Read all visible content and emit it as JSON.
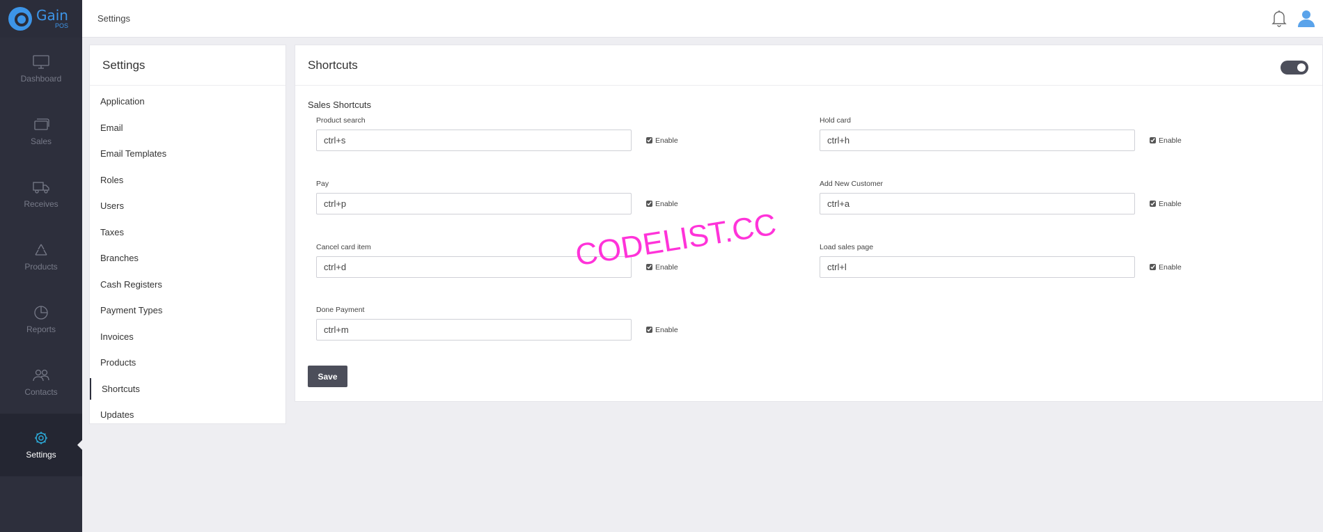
{
  "brand": {
    "name": "Gain",
    "sub": "POS"
  },
  "nav": [
    {
      "key": "dashboard",
      "label": "Dashboard",
      "icon": "monitor-icon"
    },
    {
      "key": "sales",
      "label": "Sales",
      "icon": "cards-icon"
    },
    {
      "key": "receives",
      "label": "Receives",
      "icon": "truck-icon"
    },
    {
      "key": "products",
      "label": "Products",
      "icon": "recycle-icon"
    },
    {
      "key": "reports",
      "label": "Reports",
      "icon": "pie-chart-icon"
    },
    {
      "key": "contacts",
      "label": "Contacts",
      "icon": "users-icon"
    },
    {
      "key": "settings",
      "label": "Settings",
      "icon": "gear-icon",
      "active": true
    }
  ],
  "topbar": {
    "title": "Settings"
  },
  "settings_menu": {
    "title": "Settings",
    "items": [
      "Application",
      "Email",
      "Email Templates",
      "Roles",
      "Users",
      "Taxes",
      "Branches",
      "Cash Registers",
      "Payment Types",
      "Invoices",
      "Products",
      "Shortcuts",
      "Updates"
    ],
    "active": "Shortcuts"
  },
  "shortcuts": {
    "title": "Shortcuts",
    "toggle_on": true,
    "section": "Sales Shortcuts",
    "enable_label": "Enable",
    "fields": [
      {
        "label": "Product search",
        "value": "ctrl+s",
        "enabled": true
      },
      {
        "label": "Hold card",
        "value": "ctrl+h",
        "enabled": true
      },
      {
        "label": "Pay",
        "value": "ctrl+p",
        "enabled": true
      },
      {
        "label": "Add New Customer",
        "value": "ctrl+a",
        "enabled": true
      },
      {
        "label": "Cancel card item",
        "value": "ctrl+d",
        "enabled": true
      },
      {
        "label": "Load sales page",
        "value": "ctrl+l",
        "enabled": true
      },
      {
        "label": "Done Payment",
        "value": "ctrl+m",
        "enabled": true
      }
    ],
    "save_label": "Save"
  },
  "watermark": "CODELIST.CC",
  "colors": {
    "sidebar": "#2d2f3c",
    "accent": "#3d95e8",
    "active_icon": "#2ca8d6",
    "button": "#4c4e5a",
    "watermark": "#ff33d9"
  }
}
